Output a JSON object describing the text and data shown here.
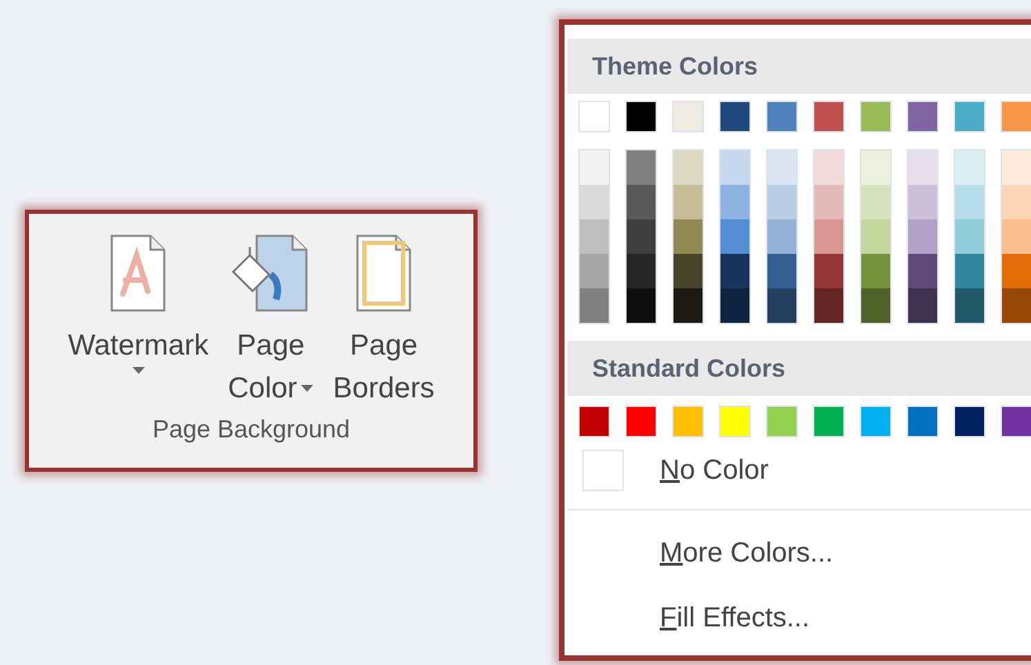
{
  "ribbon_group": {
    "title": "Page Background",
    "buttons": [
      {
        "kind": "watermark",
        "lines": [
          "Watermark"
        ],
        "dropdown": true
      },
      {
        "kind": "page_color",
        "lines": [
          "Page",
          "Color"
        ],
        "dropdown": true
      },
      {
        "kind": "page_borders",
        "lines": [
          "Page",
          "Borders"
        ],
        "dropdown": false
      }
    ]
  },
  "color_menu": {
    "theme_colors": {
      "title": "Theme Colors",
      "columns": [
        {
          "color": "#ffffff",
          "shades": [
            {
              "color": "#f2f2f2"
            },
            {
              "color": "#d9d9d9"
            },
            {
              "color": "#bfbfbf"
            },
            {
              "color": "#a6a6a6"
            },
            {
              "color": "#808080"
            }
          ]
        },
        {
          "color": "#000000",
          "shades": [
            {
              "color": "#808080"
            },
            {
              "color": "#595959"
            },
            {
              "color": "#404040"
            },
            {
              "color": "#262626"
            },
            {
              "color": "#0d0d0d"
            }
          ]
        },
        {
          "color": "#eeece1",
          "shades": [
            {
              "color": "#ddd9c3"
            },
            {
              "color": "#c4bd97"
            },
            {
              "color": "#938953"
            },
            {
              "color": "#494429"
            },
            {
              "color": "#1d1b10"
            }
          ]
        },
        {
          "color": "#1f497d",
          "shades": [
            {
              "color": "#c6d9f0"
            },
            {
              "color": "#8db3e2"
            },
            {
              "color": "#548dd4"
            },
            {
              "color": "#17365d"
            },
            {
              "color": "#0f243e"
            }
          ]
        },
        {
          "color": "#4f81bd",
          "shades": [
            {
              "color": "#dbe5f1"
            },
            {
              "color": "#b8cce4"
            },
            {
              "color": "#95b3d7"
            },
            {
              "color": "#366092"
            },
            {
              "color": "#244061"
            }
          ]
        },
        {
          "color": "#c0504d",
          "shades": [
            {
              "color": "#f2dcdb"
            },
            {
              "color": "#e5b9b7"
            },
            {
              "color": "#d99694"
            },
            {
              "color": "#953734"
            },
            {
              "color": "#632423"
            }
          ]
        },
        {
          "color": "#9bbb59",
          "shades": [
            {
              "color": "#ebf1dd"
            },
            {
              "color": "#d7e3bc"
            },
            {
              "color": "#c3d69b"
            },
            {
              "color": "#76923c"
            },
            {
              "color": "#4f6128"
            }
          ]
        },
        {
          "color": "#8064a2",
          "shades": [
            {
              "color": "#e5e0ec"
            },
            {
              "color": "#ccc1d9"
            },
            {
              "color": "#b2a2c7"
            },
            {
              "color": "#5f497a"
            },
            {
              "color": "#3f3151"
            }
          ]
        },
        {
          "color": "#4bacc6",
          "shades": [
            {
              "color": "#dbeef3"
            },
            {
              "color": "#b7dde8"
            },
            {
              "color": "#92cddc"
            },
            {
              "color": "#31859b"
            },
            {
              "color": "#205867"
            }
          ]
        },
        {
          "color": "#f79646",
          "shades": [
            {
              "color": "#fdeada"
            },
            {
              "color": "#fbd5b5"
            },
            {
              "color": "#fac08f"
            },
            {
              "color": "#e36c09"
            },
            {
              "color": "#974806"
            }
          ]
        }
      ]
    },
    "standard_colors": {
      "title": "Standard Colors",
      "swatches": [
        {
          "color": "#c00000"
        },
        {
          "color": "#ff0000"
        },
        {
          "color": "#ffc000"
        },
        {
          "color": "#ffff00"
        },
        {
          "color": "#92d050"
        },
        {
          "color": "#00b050"
        },
        {
          "color": "#00b0f0"
        },
        {
          "color": "#0070c0"
        },
        {
          "color": "#002060"
        },
        {
          "color": "#7030a0"
        }
      ]
    },
    "items": [
      {
        "kind": "no_color",
        "label": "No Color"
      },
      {
        "kind": "separator"
      },
      {
        "kind": "command",
        "label": "More Colors..."
      },
      {
        "kind": "command",
        "label": "Fill Effects..."
      }
    ]
  }
}
